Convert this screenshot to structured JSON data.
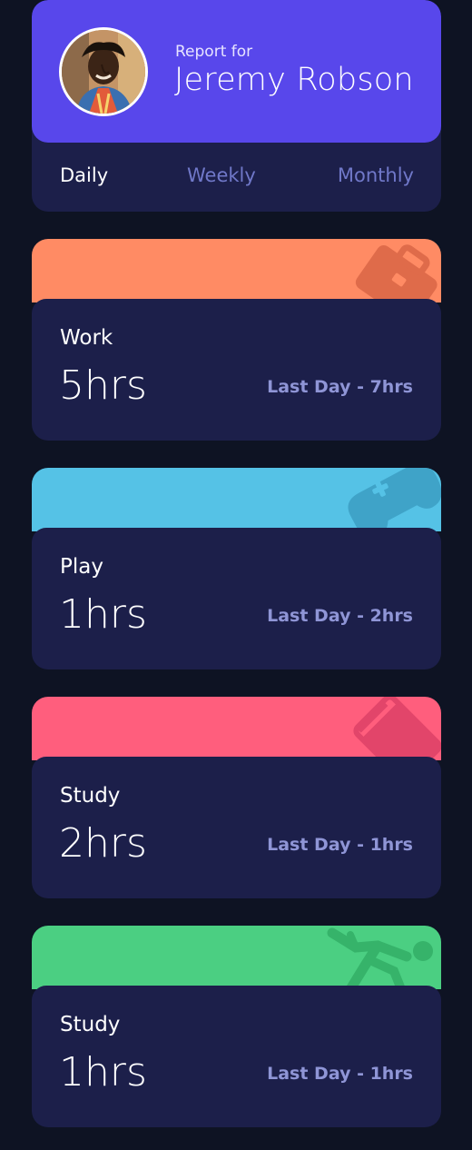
{
  "profile": {
    "report_label": "Report for",
    "name": "Jeremy Robson",
    "avatar_icon": "user-avatar-photo",
    "accent_color": "#5847eb"
  },
  "tabs": [
    {
      "label": "Daily",
      "active": true
    },
    {
      "label": "Weekly",
      "active": false
    },
    {
      "label": "Monthly",
      "active": false
    }
  ],
  "activities": [
    {
      "title": "Work",
      "hours": "5hrs",
      "previous": "Last Day - 7hrs",
      "color": "#ff8b64",
      "icon": "briefcase-icon"
    },
    {
      "title": "Play",
      "hours": "1hrs",
      "previous": "Last Day - 2hrs",
      "color": "#55c2e6",
      "icon": "gamepad-icon"
    },
    {
      "title": "Study",
      "hours": "2hrs",
      "previous": "Last Day - 1hrs",
      "color": "#ff5e7d",
      "icon": "book-icon"
    },
    {
      "title": "Study",
      "hours": "1hrs",
      "previous": "Last Day - 1hrs",
      "color": "#4bcf82",
      "icon": "running-person-icon"
    }
  ],
  "colors": {
    "page_bg": "#0e1323",
    "card_bg": "#1c1f4a",
    "muted_text": "#7078c9"
  }
}
